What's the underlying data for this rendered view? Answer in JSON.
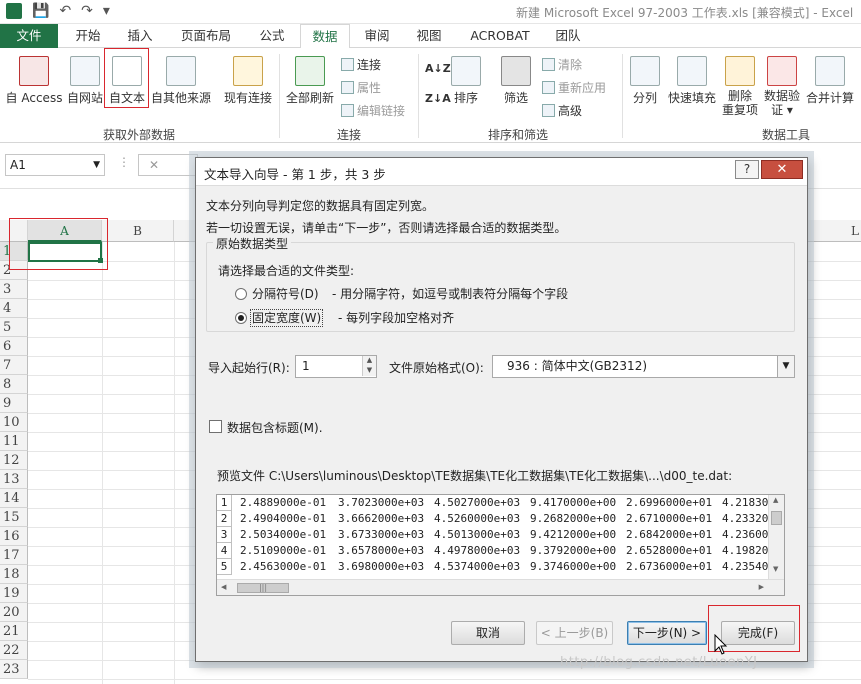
{
  "window": {
    "title": "新建 Microsoft Excel 97-2003 工作表.xls  [兼容模式] - Excel"
  },
  "qat": {
    "save": "💾",
    "undo": "↶",
    "redo": "↷",
    "more": "▾"
  },
  "tabs": [
    "文件",
    "开始",
    "插入",
    "页面布局",
    "公式",
    "数据",
    "审阅",
    "视图",
    "ACROBAT",
    "团队"
  ],
  "ribbon": {
    "ext": {
      "access": "自 Access",
      "web": "自网站",
      "text": "自文本",
      "other": "自其他来源",
      "existing": "现有连接",
      "group": "获取外部数据"
    },
    "conn": {
      "refresh": "全部刷新",
      "connections": "连接",
      "properties": "属性",
      "edit_links": "编辑链接",
      "group": "连接"
    },
    "sort": {
      "sort": "排序",
      "filter": "筛选",
      "clear": "清除",
      "reapply": "重新应用",
      "advanced": "高级",
      "group": "排序和筛选"
    },
    "tools": {
      "split": "分列",
      "flash": "快速填充",
      "remove_dup_1": "删除",
      "remove_dup_2": "重复项",
      "validate_1": "数据验",
      "validate_2": "证 ▾",
      "consolidate": "合并计算",
      "group": "数据工具"
    }
  },
  "formula": {
    "namebox": "A1",
    "cancel": "✕"
  },
  "grid": {
    "cols": [
      "A",
      "B"
    ],
    "last_col": "L",
    "rows": [
      "1",
      "2",
      "3",
      "4",
      "5",
      "6",
      "7",
      "8",
      "9",
      "10",
      "11",
      "12",
      "13",
      "14",
      "15",
      "16",
      "17",
      "18",
      "19",
      "20",
      "21",
      "22",
      "23"
    ]
  },
  "dialog": {
    "title": "文本导入向导 - 第 1 步，共 3 步",
    "help": "?",
    "close": "✕",
    "line1": "文本分列向导判定您的数据具有固定列宽。",
    "line2": "若一切设置无误，请单击“下一步”，否则请选择最合适的数据类型。",
    "group_title": "原始数据类型",
    "prompt": "请选择最合适的文件类型:",
    "opt_delim": "分隔符号(D)",
    "opt_delim_desc": "- 用分隔字符，如逗号或制表符分隔每个字段",
    "opt_fixed": "固定宽度(W)",
    "opt_fixed_desc": "- 每列字段加空格对齐",
    "start_row_label": "导入起始行(R):",
    "start_row": "1",
    "origin_label": "文件原始格式(O):",
    "origin": "936 : 简体中文(GB2312)",
    "header_label": "数据包含标题(M).",
    "preview_label": "预览文件 C:\\Users\\luminous\\Desktop\\TE数据集\\TE化工数据集\\TE化工数据集\\...\\d00_te.dat:",
    "preview_rows": [
      {
        "n": "1",
        "v": [
          "2.4889000e-01",
          "3.7023000e+03",
          "4.5027000e+03",
          "9.4170000e+00",
          "2.6996000e+01",
          "4.21830"
        ]
      },
      {
        "n": "2",
        "v": [
          "2.4904000e-01",
          "3.6662000e+03",
          "4.5260000e+03",
          "9.2682000e+00",
          "2.6710000e+01",
          "4.23320"
        ]
      },
      {
        "n": "3",
        "v": [
          "2.5034000e-01",
          "3.6733000e+03",
          "4.5013000e+03",
          "9.4212000e+00",
          "2.6842000e+01",
          "4.23600"
        ]
      },
      {
        "n": "4",
        "v": [
          "2.5109000e-01",
          "3.6578000e+03",
          "4.4978000e+03",
          "9.3792000e+00",
          "2.6528000e+01",
          "4.19820"
        ]
      },
      {
        "n": "5",
        "v": [
          "2.4563000e-01",
          "3.6980000e+03",
          "4.5374000e+03",
          "9.3746000e+00",
          "2.6736000e+01",
          "4.23540"
        ]
      }
    ],
    "buttons": {
      "cancel": "取消",
      "back": "< 上一步(B)",
      "next": "下一步(N) >",
      "finish": "完成(F)"
    }
  },
  "watermark": "http://blog.csdn.net/LuoenYJ"
}
